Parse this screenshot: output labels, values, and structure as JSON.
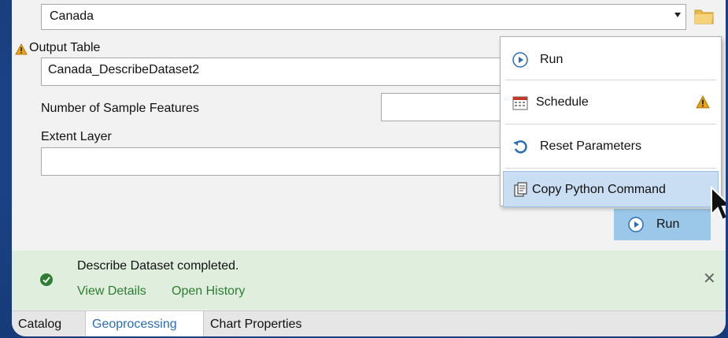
{
  "dataset": {
    "value": "Canada"
  },
  "output_table": {
    "label": "Output Table",
    "value": "Canada_DescribeDataset2"
  },
  "sample_features": {
    "label": "Number of Sample Features",
    "value": ""
  },
  "extent_layer": {
    "label": "Extent Layer",
    "value": ""
  },
  "run_button": {
    "label": "Run"
  },
  "context_menu": {
    "items": [
      {
        "label": "Run",
        "icon": "run-icon"
      },
      {
        "label": "Schedule",
        "icon": "calendar-icon"
      },
      {
        "label": "Reset Parameters",
        "icon": "reset-icon"
      },
      {
        "label": "Copy Python Command",
        "icon": "copy-icon"
      }
    ]
  },
  "status": {
    "message": "Describe Dataset completed.",
    "view_details": "View Details",
    "open_history": "Open History"
  },
  "tabs": [
    {
      "label": "Catalog"
    },
    {
      "label": "Geoprocessing"
    },
    {
      "label": "Chart Properties"
    }
  ],
  "colors": {
    "accent": "#2a6db5",
    "run_button_bg": "#9bc7e8",
    "success_bg": "#dfeedd",
    "success_link": "#2f7d32",
    "warning": "#e8a317"
  }
}
